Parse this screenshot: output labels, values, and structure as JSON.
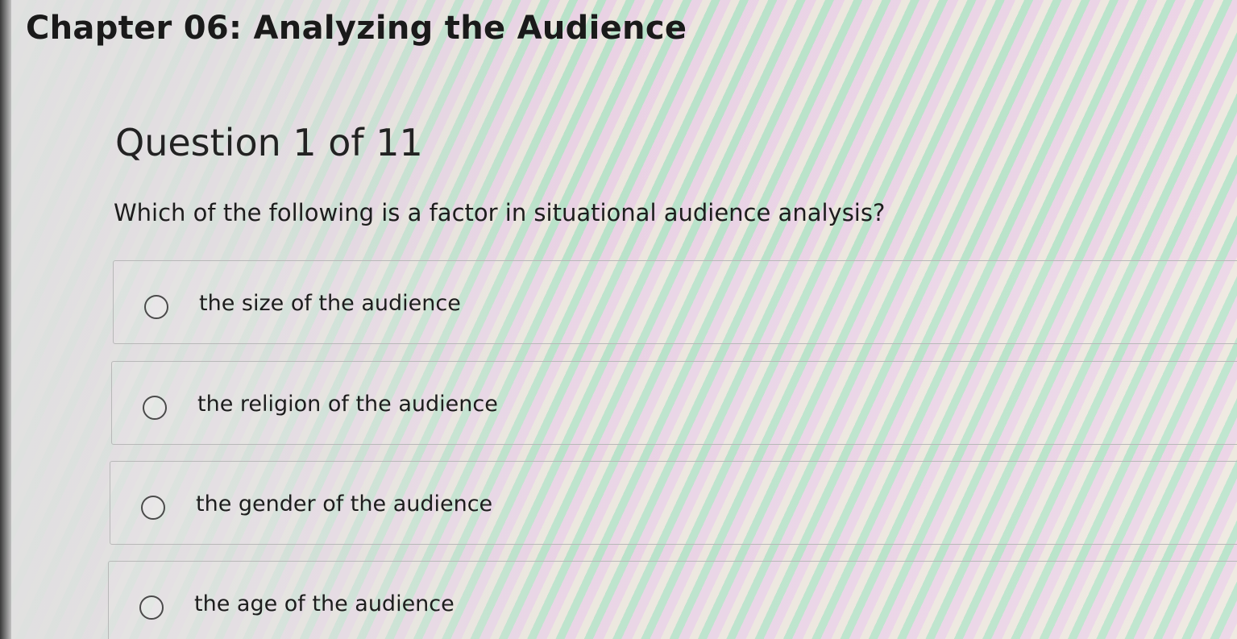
{
  "chapter_title": "Chapter 06: Analyzing the Audience",
  "question_counter": "Question 1 of 11",
  "question_text": "Which of the following is a factor in situational audience analysis?",
  "options": [
    {
      "label": "the size of the audience",
      "selected": false
    },
    {
      "label": "the religion of the audience",
      "selected": false
    },
    {
      "label": "the gender of the audience",
      "selected": false
    },
    {
      "label": "the age of the audience",
      "selected": false
    }
  ]
}
